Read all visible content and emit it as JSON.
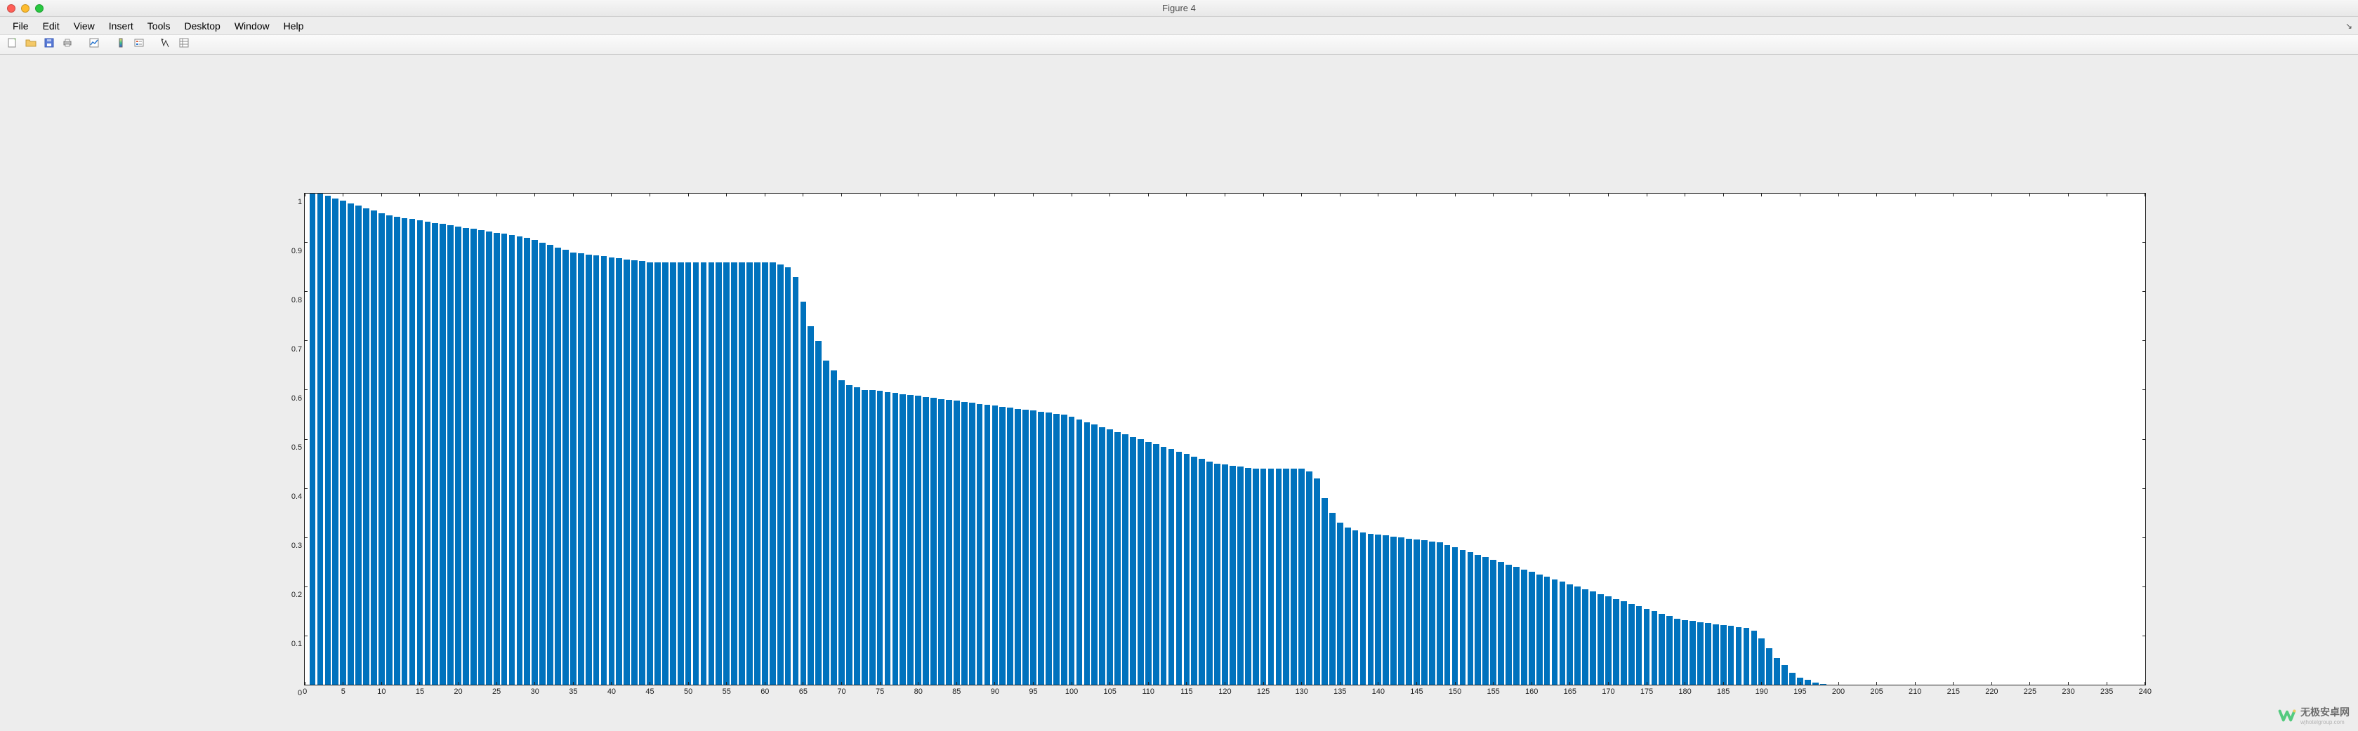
{
  "window": {
    "title": "Figure 4"
  },
  "menubar": {
    "items": [
      "File",
      "Edit",
      "View",
      "Insert",
      "Tools",
      "Desktop",
      "Window",
      "Help"
    ],
    "overflow_glyph": "↘"
  },
  "toolbar": {
    "buttons": [
      {
        "name": "new-figure-icon",
        "title": "New Figure"
      },
      {
        "name": "open-icon",
        "title": "Open"
      },
      {
        "name": "save-icon",
        "title": "Save"
      },
      {
        "name": "print-icon",
        "title": "Print"
      },
      {
        "name": "sep"
      },
      {
        "name": "link-plot-icon",
        "title": "Link Plot"
      },
      {
        "name": "sep"
      },
      {
        "name": "insert-colorbar-icon",
        "title": "Insert Colorbar"
      },
      {
        "name": "insert-legend-icon",
        "title": "Insert Legend"
      },
      {
        "name": "sep"
      },
      {
        "name": "edit-plot-icon",
        "title": "Edit Plot"
      },
      {
        "name": "property-inspector-icon",
        "title": "Open Property Inspector"
      }
    ]
  },
  "watermark": {
    "text": "无极安卓网",
    "sub": "wjhotelgroup.com"
  },
  "chart_data": {
    "type": "bar",
    "title": "",
    "xlabel": "",
    "ylabel": "",
    "xlim": [
      0,
      240
    ],
    "ylim": [
      0,
      1
    ],
    "xticks": [
      0,
      5,
      10,
      15,
      20,
      25,
      30,
      35,
      40,
      45,
      50,
      55,
      60,
      65,
      70,
      75,
      80,
      85,
      90,
      95,
      100,
      105,
      110,
      115,
      120,
      125,
      130,
      135,
      140,
      145,
      150,
      155,
      160,
      165,
      170,
      175,
      180,
      185,
      190,
      195,
      200,
      205,
      210,
      215,
      220,
      225,
      230,
      235,
      240
    ],
    "yticks": [
      0,
      0.1,
      0.2,
      0.3,
      0.4,
      0.5,
      0.6,
      0.7,
      0.8,
      0.9,
      1
    ],
    "bar_color": "#0072bd",
    "categories_start": 1,
    "values": [
      1.0,
      1.0,
      0.995,
      0.99,
      0.985,
      0.98,
      0.975,
      0.97,
      0.965,
      0.96,
      0.955,
      0.952,
      0.95,
      0.948,
      0.945,
      0.943,
      0.94,
      0.938,
      0.935,
      0.932,
      0.93,
      0.928,
      0.925,
      0.922,
      0.92,
      0.918,
      0.915,
      0.912,
      0.91,
      0.905,
      0.9,
      0.895,
      0.89,
      0.885,
      0.88,
      0.878,
      0.876,
      0.874,
      0.872,
      0.87,
      0.868,
      0.866,
      0.864,
      0.862,
      0.86,
      0.86,
      0.86,
      0.86,
      0.86,
      0.86,
      0.86,
      0.86,
      0.86,
      0.86,
      0.86,
      0.86,
      0.86,
      0.86,
      0.86,
      0.86,
      0.86,
      0.855,
      0.85,
      0.83,
      0.78,
      0.73,
      0.7,
      0.66,
      0.64,
      0.62,
      0.61,
      0.605,
      0.6,
      0.6,
      0.598,
      0.596,
      0.594,
      0.592,
      0.59,
      0.588,
      0.586,
      0.584,
      0.582,
      0.58,
      0.578,
      0.576,
      0.574,
      0.572,
      0.57,
      0.568,
      0.566,
      0.564,
      0.562,
      0.56,
      0.558,
      0.556,
      0.554,
      0.552,
      0.55,
      0.545,
      0.54,
      0.535,
      0.53,
      0.525,
      0.52,
      0.515,
      0.51,
      0.505,
      0.5,
      0.495,
      0.49,
      0.485,
      0.48,
      0.475,
      0.47,
      0.465,
      0.46,
      0.455,
      0.45,
      0.448,
      0.446,
      0.444,
      0.442,
      0.44,
      0.44,
      0.44,
      0.44,
      0.44,
      0.44,
      0.44,
      0.435,
      0.42,
      0.38,
      0.35,
      0.33,
      0.32,
      0.315,
      0.31,
      0.308,
      0.306,
      0.304,
      0.302,
      0.3,
      0.298,
      0.296,
      0.294,
      0.292,
      0.29,
      0.285,
      0.28,
      0.275,
      0.27,
      0.265,
      0.26,
      0.255,
      0.25,
      0.245,
      0.24,
      0.235,
      0.23,
      0.225,
      0.22,
      0.215,
      0.21,
      0.205,
      0.2,
      0.195,
      0.19,
      0.185,
      0.18,
      0.175,
      0.17,
      0.165,
      0.16,
      0.155,
      0.15,
      0.145,
      0.14,
      0.135,
      0.132,
      0.13,
      0.128,
      0.126,
      0.124,
      0.122,
      0.12,
      0.118,
      0.116,
      0.11,
      0.095,
      0.075,
      0.055,
      0.04,
      0.025,
      0.015,
      0.01,
      0.005,
      0.002
    ]
  },
  "axes_geometry": {
    "left_pct": 12.9,
    "top_pct": 20.4,
    "width_pct": 78.1,
    "height_pct": 72.9
  }
}
